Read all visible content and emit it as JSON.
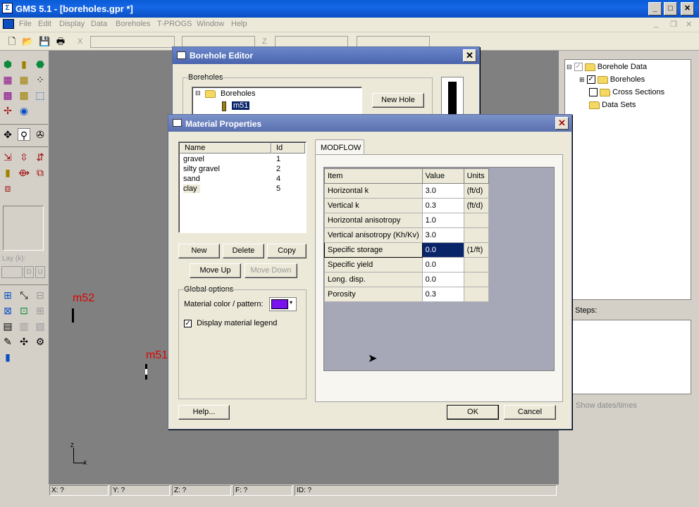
{
  "app": {
    "title": "GMS 5.1 - [boreholes.gpr *]",
    "menus": [
      "File",
      "Edit",
      "Display",
      "Data",
      "Boreholes",
      "T-PROGS",
      "Window",
      "Help"
    ],
    "toolbar_coords": {
      "x": "X",
      "y": "Y",
      "z": "Z"
    }
  },
  "left_panel": {
    "lay_label": "Lay (k):",
    "d_btn": "D",
    "u_btn": "U"
  },
  "viewport": {
    "borehole_m52": "m52",
    "borehole_m51": "m51",
    "axis_z": "Z",
    "axis_x": "X"
  },
  "status": {
    "x": "X: ?",
    "y": "Y: ?",
    "z": "Z: ?",
    "f": "F: ?",
    "id": "ID: ?"
  },
  "right_panel": {
    "tree": {
      "root": "Borehole Data",
      "boreholes": "Boreholes",
      "cross_sections": "Cross Sections",
      "data_sets": "Data Sets"
    },
    "time_steps": "e Steps:",
    "show_dates": "Show dates/times"
  },
  "borehole_editor": {
    "title": "Borehole Editor",
    "group_label": "Boreholes",
    "tree_root": "Boreholes",
    "tree_child": "m51",
    "new_hole": "New Hole"
  },
  "material_props": {
    "title": "Material Properties",
    "list_headers": {
      "name": "Name",
      "id": "Id"
    },
    "materials": [
      {
        "name": "gravel",
        "id": "1"
      },
      {
        "name": "silty gravel",
        "id": "2"
      },
      {
        "name": "sand",
        "id": "4"
      },
      {
        "name": "clay",
        "id": "5"
      }
    ],
    "buttons": {
      "new": "New",
      "delete": "Delete",
      "copy": "Copy",
      "move_up": "Move Up",
      "move_down": "Move Down",
      "help": "Help...",
      "ok": "OK",
      "cancel": "Cancel"
    },
    "global_options": "Global options",
    "material_color_label": "Material color / pattern:",
    "material_color": "#7a12f0",
    "display_legend": "Display material legend",
    "tab": "MODFLOW",
    "table_headers": {
      "item": "Item",
      "value": "Value",
      "units": "Units"
    },
    "rows": [
      {
        "item": "Horizontal k",
        "value": "3.0",
        "units": "(ft/d)"
      },
      {
        "item": "Vertical k",
        "value": "0.3",
        "units": "(ft/d)"
      },
      {
        "item": "Horizontal anisotropy",
        "value": "1.0",
        "units": ""
      },
      {
        "item": "Vertical anisotropy (Kh/Kv)",
        "value": "3.0",
        "units": ""
      },
      {
        "item": "Specific storage",
        "value": "0.0",
        "units": "(1/ft)"
      },
      {
        "item": "Specific yield",
        "value": "0.0",
        "units": ""
      },
      {
        "item": "Long. disp.",
        "value": "0.0",
        "units": ""
      },
      {
        "item": "Porosity",
        "value": "0.3",
        "units": ""
      }
    ]
  }
}
